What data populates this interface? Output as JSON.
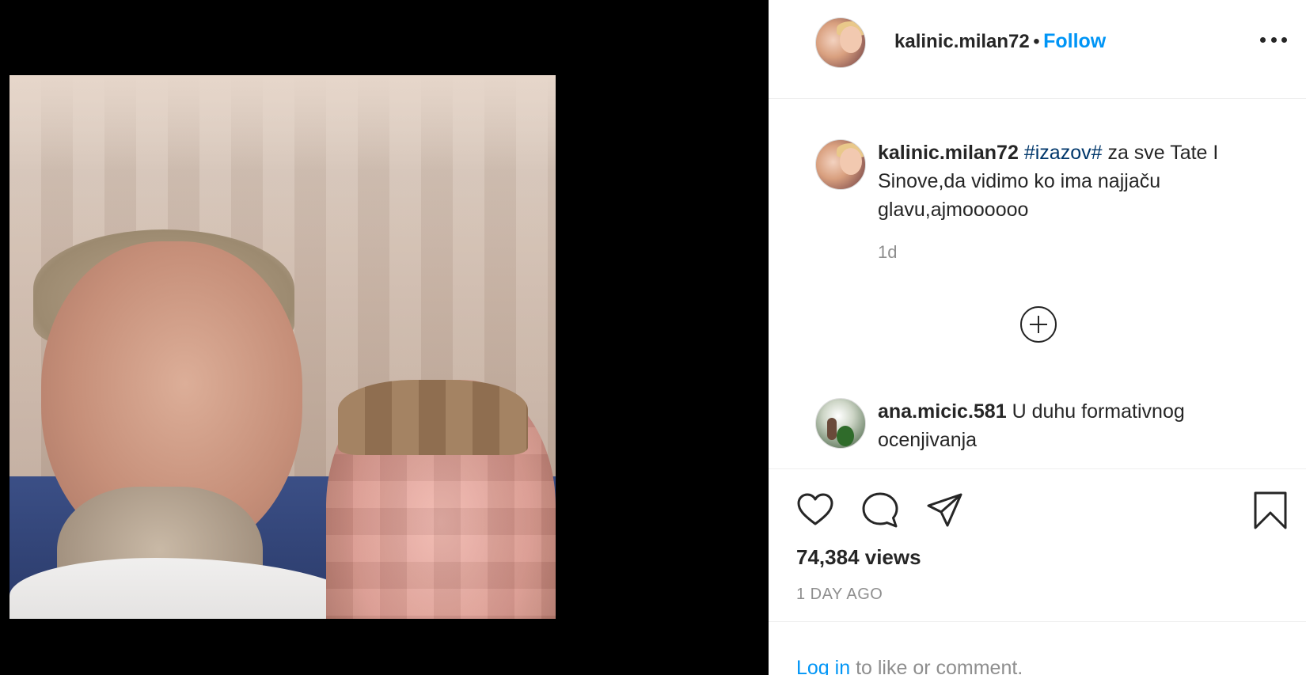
{
  "post": {
    "author": "kalinic.milan72",
    "bullet": "•",
    "follow_label": "Follow",
    "more_icon": "more-horizontal-icon"
  },
  "caption": {
    "username": "kalinic.milan72",
    "hashtag": "#izazov#",
    "text": " za sve Tate I Sinove,da vidimo ko ima najjaču glavu,ajmoooooo",
    "time_ago": "1d"
  },
  "load_more_icon": "plus-circle-icon",
  "comment": {
    "username": "ana.micic.581",
    "text": " U duhu formativnog ocenjivanja"
  },
  "actions": {
    "like_icon": "heart-icon",
    "comment_icon": "comment-icon",
    "share_icon": "paper-plane-icon",
    "save_icon": "bookmark-icon"
  },
  "stats": {
    "views": "74,384 views",
    "date": "1 DAY AGO"
  },
  "login": {
    "link": "Log in",
    "rest": " to like or comment."
  },
  "colors": {
    "link_blue": "#0095f6",
    "hashtag_blue": "#00376b",
    "text": "#262626",
    "muted": "#8e8e8e"
  }
}
